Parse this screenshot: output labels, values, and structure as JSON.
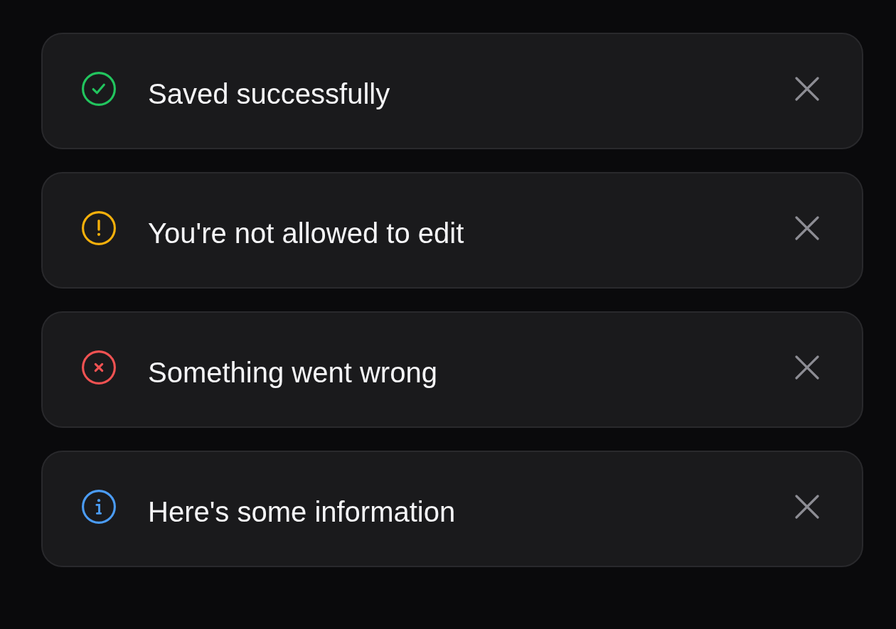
{
  "toasts": [
    {
      "kind": "success",
      "color": "#22c55e",
      "message": "Saved successfully"
    },
    {
      "kind": "warning",
      "color": "#f5b00b",
      "message": "You're not allowed to edit"
    },
    {
      "kind": "error",
      "color": "#f05252",
      "message": "Something went wrong"
    },
    {
      "kind": "info",
      "color": "#4b9cf5",
      "message": "Here's some information"
    }
  ]
}
